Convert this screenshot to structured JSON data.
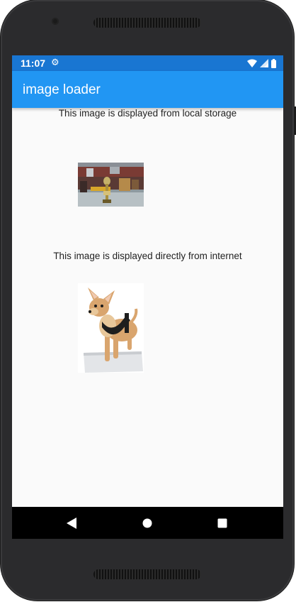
{
  "status_bar": {
    "time": "11:07",
    "icons": [
      "settings-icon",
      "wifi-icon",
      "signal-icon",
      "battery-icon"
    ],
    "color": "#1976d2"
  },
  "app_bar": {
    "title": "image loader",
    "color": "#2196f3"
  },
  "content": {
    "local_caption": "This image is displayed from local storage",
    "local_image_icon": "trophy-photo",
    "internet_caption": "This image is displayed directly from internet",
    "internet_image_icon": "chihuahua-photo"
  },
  "nav_bar": {
    "buttons": [
      "back-icon",
      "home-icon",
      "recents-icon"
    ]
  }
}
